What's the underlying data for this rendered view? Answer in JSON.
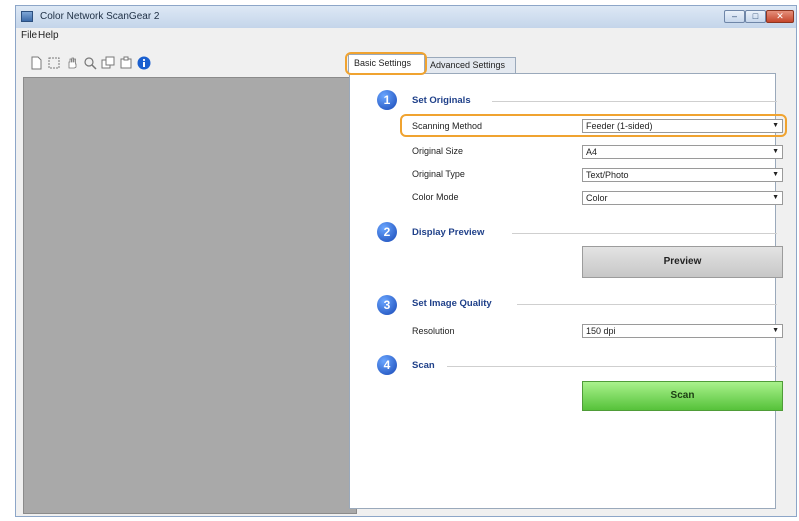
{
  "window": {
    "title": "Color Network ScanGear 2",
    "controls": {
      "minimize": "–",
      "maximize": "□",
      "close": "✕"
    }
  },
  "menu": {
    "file": "File",
    "help": "Help"
  },
  "toolbar": {
    "icons": [
      "new-page-icon",
      "select-frame-icon",
      "hand-pan-icon",
      "zoom-icon",
      "copy-frame-icon",
      "rotate-frame-icon",
      "info-icon"
    ]
  },
  "tabs": {
    "basic": "Basic Settings",
    "advanced": "Advanced Settings",
    "active": "basic"
  },
  "sections": {
    "set_originals": {
      "number": "1",
      "title": "Set Originals"
    },
    "display_preview": {
      "number": "2",
      "title": "Display Preview"
    },
    "set_image_quality": {
      "number": "3",
      "title": "Set Image Quality"
    },
    "scan": {
      "number": "4",
      "title": "Scan"
    }
  },
  "fields": {
    "scanning_method": {
      "label": "Scanning Method",
      "value": "Feeder (1-sided)"
    },
    "original_size": {
      "label": "Original Size",
      "value": "A4"
    },
    "original_type": {
      "label": "Original Type",
      "value": "Text/Photo"
    },
    "color_mode": {
      "label": "Color Mode",
      "value": "Color"
    },
    "resolution": {
      "label": "Resolution",
      "value": "150 dpi"
    }
  },
  "buttons": {
    "preview": "Preview",
    "scan": "Scan"
  },
  "colors": {
    "highlight": "#f0a330",
    "step_circle": "#1747b5",
    "scan_button": "#56c23a",
    "preview_bg": "#a9a9a9"
  }
}
